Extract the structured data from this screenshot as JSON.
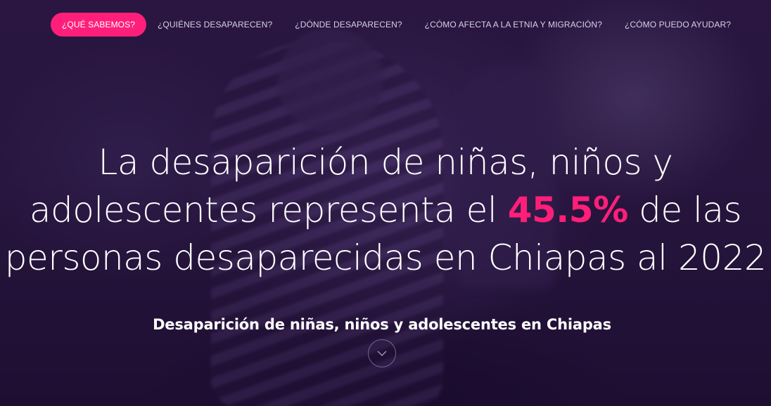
{
  "nav": {
    "items": [
      {
        "label": "¿QUÉ SABEMOS?",
        "active": true
      },
      {
        "label": "¿QUIÉNES DESAPARECEN?",
        "active": false
      },
      {
        "label": "¿DÓNDE DESAPARECEN?",
        "active": false
      },
      {
        "label": "¿CÓMO AFECTA A LA ETNIA Y MIGRACIÓN?",
        "active": false
      },
      {
        "label": "¿CÓMO PUEDO AYUDAR?",
        "active": false
      }
    ]
  },
  "hero": {
    "line1": "La desaparición de niñas, niños y",
    "line2_before": "adolescentes representa el ",
    "line2_highlight": "45.5%",
    "line2_after": " de las",
    "line3": "personas desaparecidas en Chiapas al 2022",
    "subtitle": "Desaparición de niñas, niños y adolescentes en Chiapas",
    "scroll_icon": "chevron-down-icon"
  },
  "colors": {
    "accent": "#ff1f7a",
    "background": "#231236",
    "text": "#ffffff"
  }
}
